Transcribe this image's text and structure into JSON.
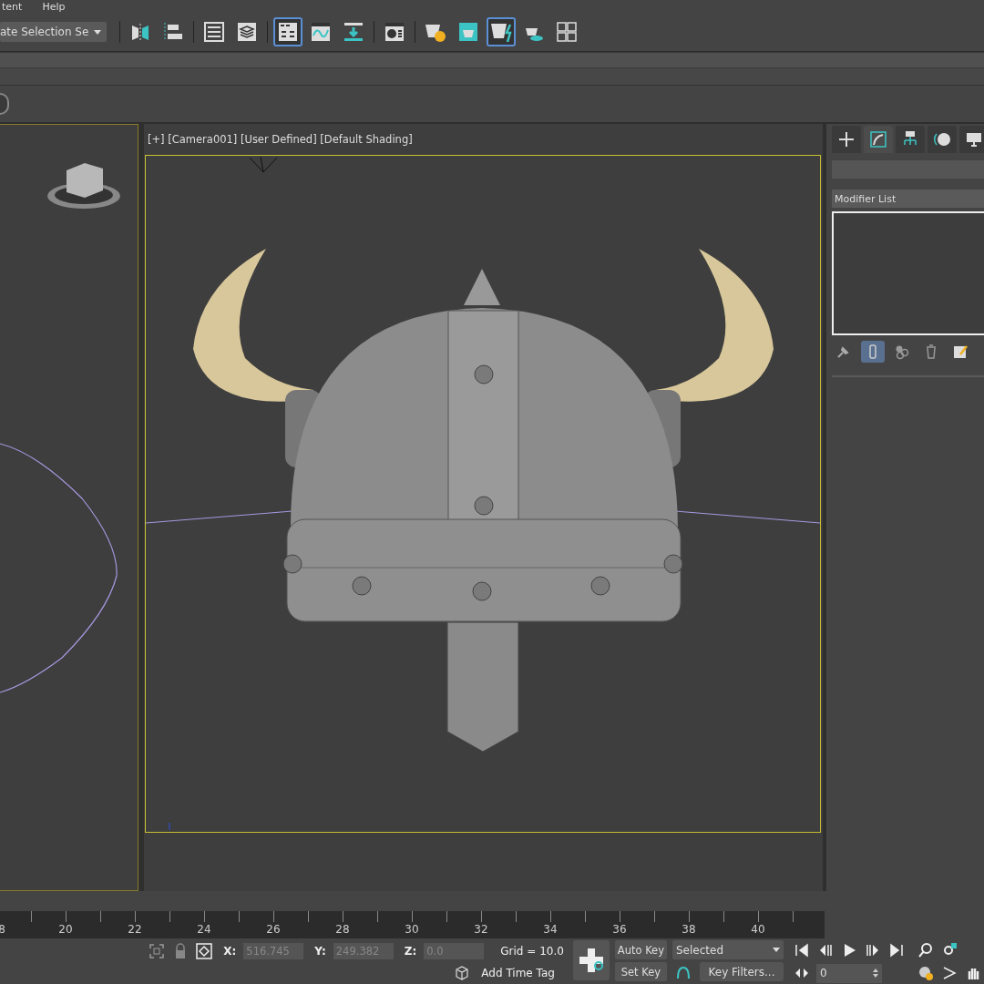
{
  "menu_bar": {
    "items": [
      "tent",
      "Help"
    ]
  },
  "main_toolbar": {
    "selection_set": "ate Selection Se",
    "buttons": [
      {
        "kind": "mirror",
        "selected": false
      },
      {
        "kind": "align",
        "selected": false
      },
      {
        "kind": "list",
        "selected": false
      },
      {
        "kind": "layers",
        "selected": false
      },
      {
        "kind": "ribbon",
        "selected": true
      },
      {
        "kind": "curve",
        "selected": false
      },
      {
        "kind": "download",
        "selected": false
      },
      {
        "kind": "material",
        "selected": false
      },
      {
        "kind": "teapot-gear",
        "selected": false
      },
      {
        "kind": "teapot-window",
        "selected": false
      },
      {
        "kind": "teapot-bolt",
        "selected": true
      },
      {
        "kind": "teapot-cloud",
        "selected": false
      },
      {
        "kind": "grid",
        "selected": false
      }
    ]
  },
  "viewport": {
    "label": "[+] [Camera001] [User Defined] [Default Shading]"
  },
  "command_panel": {
    "tabs": [
      {
        "kind": "plus",
        "selected": false
      },
      {
        "kind": "modify",
        "selected": true
      },
      {
        "kind": "hierarchy",
        "selected": false
      },
      {
        "kind": "motion",
        "selected": false
      },
      {
        "kind": "display",
        "selected": false
      }
    ],
    "modifier_list": "Modifier List",
    "stack_tools": [
      {
        "kind": "pin",
        "selected": false
      },
      {
        "kind": "end-result",
        "selected": true
      },
      {
        "kind": "unique",
        "selected": false
      },
      {
        "kind": "trash",
        "selected": false
      },
      {
        "kind": "configure",
        "selected": false
      }
    ]
  },
  "timeline": {
    "ticks": [
      "8",
      "20",
      "22",
      "24",
      "26",
      "28",
      "30",
      "32",
      "34",
      "36",
      "38",
      "40"
    ]
  },
  "status_bar": {
    "coordinates": [
      {
        "label": "X:",
        "value": "516.745"
      },
      {
        "label": "Y:",
        "value": "249.382"
      },
      {
        "label": "Z:",
        "value": "0.0"
      }
    ],
    "grid": "Grid = 10.0",
    "time_tag": "Add Time Tag",
    "auto_key": "Auto Key",
    "set_key": "Set Key",
    "key_mode": "Selected",
    "key_filters": "Key Filters...",
    "frame": "0"
  }
}
